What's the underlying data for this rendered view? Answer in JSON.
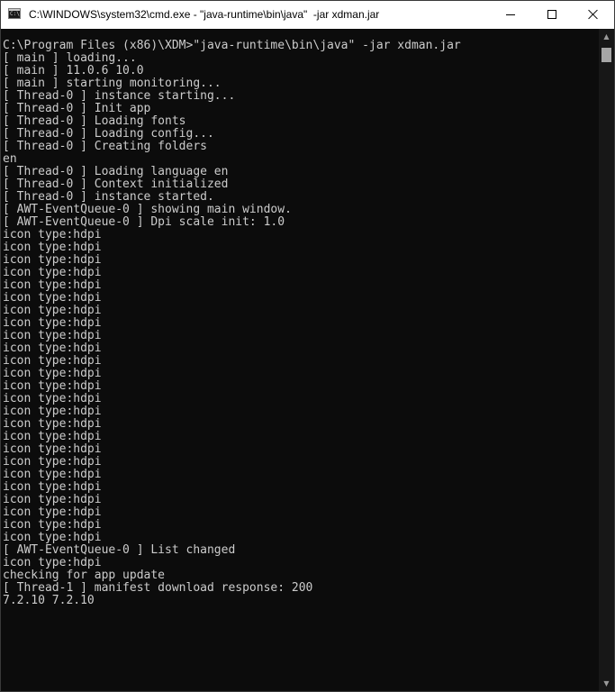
{
  "window": {
    "title": "C:\\WINDOWS\\system32\\cmd.exe - \"java-runtime\\bin\\java\"  -jar xdman.jar",
    "icon": "cmd-console-icon",
    "controls": {
      "minimize": "minimize-icon",
      "maximize": "maximize-icon",
      "close": "close-icon"
    }
  },
  "console": {
    "lines": [
      "C:\\Program Files (x86)\\XDM>\"java-runtime\\bin\\java\" -jar xdman.jar",
      "[ main ] loading...",
      "[ main ] 11.0.6 10.0",
      "[ main ] starting monitoring...",
      "[ Thread-0 ] instance starting...",
      "[ Thread-0 ] Init app",
      "[ Thread-0 ] Loading fonts",
      "[ Thread-0 ] Loading config...",
      "[ Thread-0 ] Creating folders",
      "en",
      "[ Thread-0 ] Loading language en",
      "[ Thread-0 ] Context initialized",
      "[ Thread-0 ] instance started.",
      "[ AWT-EventQueue-0 ] showing main window.",
      "[ AWT-EventQueue-0 ] Dpi scale init: 1.0",
      "icon type:hdpi",
      "icon type:hdpi",
      "icon type:hdpi",
      "icon type:hdpi",
      "icon type:hdpi",
      "icon type:hdpi",
      "icon type:hdpi",
      "icon type:hdpi",
      "icon type:hdpi",
      "icon type:hdpi",
      "icon type:hdpi",
      "icon type:hdpi",
      "icon type:hdpi",
      "icon type:hdpi",
      "icon type:hdpi",
      "icon type:hdpi",
      "icon type:hdpi",
      "icon type:hdpi",
      "icon type:hdpi",
      "icon type:hdpi",
      "icon type:hdpi",
      "icon type:hdpi",
      "icon type:hdpi",
      "icon type:hdpi",
      "icon type:hdpi",
      "[ AWT-EventQueue-0 ] List changed",
      "icon type:hdpi",
      "checking for app update",
      "[ Thread-1 ] manifest download response: 200",
      "7.2.10 7.2.10"
    ]
  },
  "scrollbar": {
    "up_arrow": "▲",
    "down_arrow": "▼",
    "up_icon": "scroll-up-arrow-icon",
    "down_icon": "scroll-down-arrow-icon"
  },
  "colors": {
    "console_background": "#0c0c0c",
    "console_text": "#cccccc",
    "titlebar_background": "#ffffff"
  }
}
